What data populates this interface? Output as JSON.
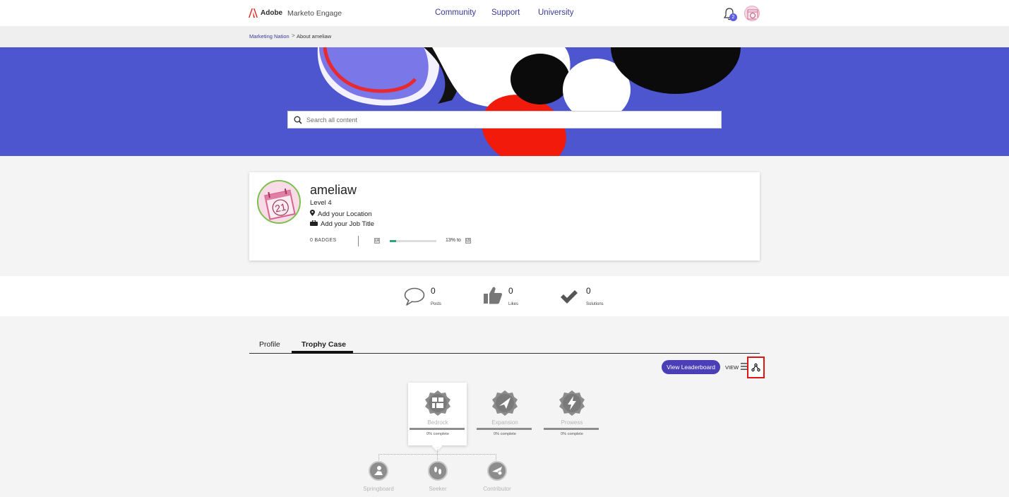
{
  "header": {
    "brand": "Adobe",
    "product": "Marketo Engage",
    "nav": [
      "Community",
      "Support",
      "University"
    ],
    "notification_count": "2"
  },
  "breadcrumb": {
    "root": "Marketing Nation",
    "separator": ">",
    "current": "About ameliaw"
  },
  "search": {
    "placeholder": "Search all content"
  },
  "profile": {
    "username": "ameliaw",
    "level": "Level 4",
    "location": "Add your Location",
    "job_title": "Add your Job Title",
    "badges": "0 BADGES",
    "current_level_icon": "L4",
    "next_level_icon": "L5",
    "progress_fraction": 0.13,
    "progress_text": "13% to",
    "avatar_text": "21"
  },
  "stats": [
    {
      "value": "0",
      "label": "Posts",
      "icon": "speech-bubble-icon"
    },
    {
      "value": "0",
      "label": "Likes",
      "icon": "thumbs-up-icon"
    },
    {
      "value": "0",
      "label": "Solutions",
      "icon": "checkmark-icon"
    }
  ],
  "tabs": [
    "Profile",
    "Trophy Case"
  ],
  "active_tab": "Trophy Case",
  "toolbar": {
    "leaderboard_label": "View Leaderboard",
    "view_label": "VIEW"
  },
  "trophies": [
    {
      "name": "Bedrock",
      "status": "0% complete",
      "icon": "bedrock-icon"
    },
    {
      "name": "Expansion",
      "status": "0% complete",
      "icon": "paper-plane-icon"
    },
    {
      "name": "Prowess",
      "status": "0% complete",
      "icon": "lightning-icon"
    }
  ],
  "sub_trophies": [
    {
      "name": "Springboard",
      "icon": "springboard-icon"
    },
    {
      "name": "Seeker",
      "icon": "footprints-icon"
    },
    {
      "name": "Contributor",
      "icon": "contributor-icon"
    }
  ],
  "colors": {
    "hero_bg": "#4d55cf",
    "accent": "#4b3fb8",
    "highlight": "#e31414",
    "progress": "#2fa67a"
  }
}
